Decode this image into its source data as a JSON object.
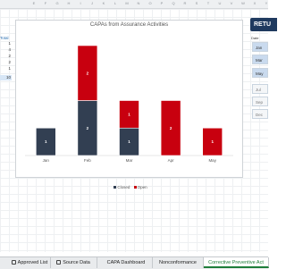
{
  "column_headers": [
    "E",
    "F",
    "G",
    "H",
    "I",
    "J",
    "K",
    "L",
    "M",
    "N",
    "O",
    "P",
    "Q",
    "R",
    "S",
    "T",
    "U",
    "V",
    "W",
    "X",
    "Y"
  ],
  "left_column": {
    "label": "Total",
    "values": [
      "1",
      "4",
      "2",
      "2",
      "1",
      "10"
    ]
  },
  "chart": {
    "title": "CAPAs from Assurance Activities"
  },
  "chart_data": {
    "type": "bar",
    "title": "CAPAs from Assurance Activities",
    "categories": [
      "Jan",
      "Feb",
      "Mar",
      "Apr",
      "May"
    ],
    "series": [
      {
        "name": "Closed",
        "values": [
          1,
          2,
          1,
          0,
          0
        ],
        "color": "#323f52"
      },
      {
        "name": "Open",
        "values": [
          0,
          2,
          1,
          2,
          1
        ],
        "color": "#c8000f"
      }
    ],
    "stacked": true,
    "ylim": [
      0,
      4
    ],
    "legend": "bottom",
    "grid": false
  },
  "right_panel": {
    "return_label": "RETU",
    "date_label": "Date",
    "months": [
      {
        "label": "Jan",
        "selected": true
      },
      {
        "label": "Mar",
        "selected": true
      },
      {
        "label": "May",
        "selected": true
      },
      {
        "label": "Jul",
        "selected": false
      },
      {
        "label": "Sep",
        "selected": false
      },
      {
        "label": "Dec",
        "selected": false
      }
    ]
  },
  "tabs": [
    {
      "label": "Approved List",
      "locked": true,
      "active": false
    },
    {
      "label": "Source Data",
      "locked": true,
      "active": false
    },
    {
      "label": "CAPA Dashboard",
      "locked": false,
      "active": false
    },
    {
      "label": "Nonconformance",
      "locked": false,
      "active": false
    },
    {
      "label": "Corrective Preventive Act",
      "locked": false,
      "active": true
    }
  ]
}
